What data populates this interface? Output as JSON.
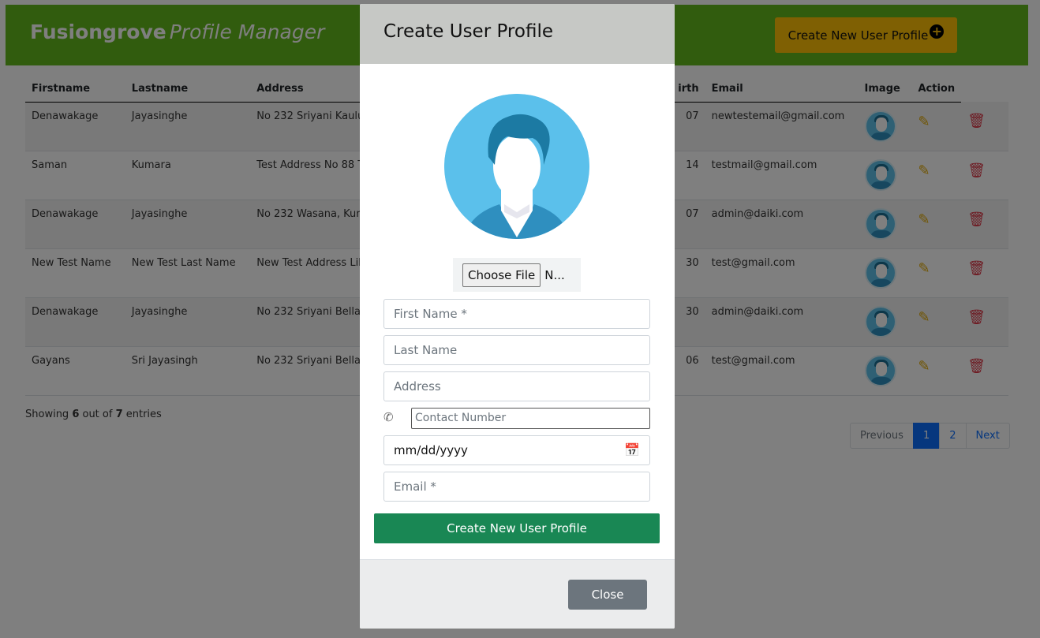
{
  "header": {
    "brand_bold": "Fusiongrove",
    "brand_italic": "Profile Manager",
    "create_button": "Create New User Profile",
    "create_icon": "plus-circle-icon"
  },
  "table": {
    "columns": [
      "Firstname",
      "Lastname",
      "Address",
      "irth",
      "Email",
      "Image",
      "Action",
      ""
    ],
    "rows": [
      {
        "firstname": "Denawakage",
        "lastname": "Jayasinghe",
        "address": "No 232 Sriyani Kaulu",
        "birth": "07",
        "email": "newtestemail@gmail.com"
      },
      {
        "firstname": "Saman",
        "lastname": "Kumara",
        "address": "Test Address No 88 T",
        "birth": "14",
        "email": "testmail@gmail.com"
      },
      {
        "firstname": "Denawakage",
        "lastname": "Jayasinghe",
        "address": "No 232 Wasana, Kuru",
        "birth": "07",
        "email": "admin@daiki.com"
      },
      {
        "firstname": "New Test Name",
        "lastname": "New Test Last Name",
        "address": "New Test Address Lik",
        "birth": "30",
        "email": "test@gmail.com"
      },
      {
        "firstname": "Denawakage",
        "lastname": "Jayasinghe",
        "address": "No 232 Sriyani Bellan",
        "birth": "30",
        "email": "admin@daiki.com"
      },
      {
        "firstname": "Gayans",
        "lastname": "Sri Jayasingh",
        "address": "No 232 Sriyani Bellan",
        "birth": "06",
        "email": "test@gmail.com"
      }
    ]
  },
  "footer": {
    "showing_prefix": "Showing ",
    "showing_count": "6",
    "showing_mid": " out of ",
    "showing_total": "7",
    "showing_suffix": " entries"
  },
  "pagination": {
    "previous": "Previous",
    "pages": [
      "1",
      "2"
    ],
    "next": "Next",
    "active_page": "1"
  },
  "modal": {
    "title": "Create User Profile",
    "choose_file": "Choose File",
    "file_status": "N...",
    "first_name_placeholder": "First Name *",
    "last_name_placeholder": "Last Name",
    "address_placeholder": "Address",
    "contact_placeholder": "Contact Number",
    "date_placeholder": "mm/dd/yyyy",
    "email_placeholder": "Email *",
    "submit": "Create New User Profile",
    "close": "Close"
  },
  "colors": {
    "header_bg": "#63b81d",
    "accent_yellow": "#ffc107",
    "submit_green": "#198754",
    "danger_red": "#dc3545",
    "close_grey": "#6c757d",
    "active_page_blue": "#0d6efd"
  }
}
